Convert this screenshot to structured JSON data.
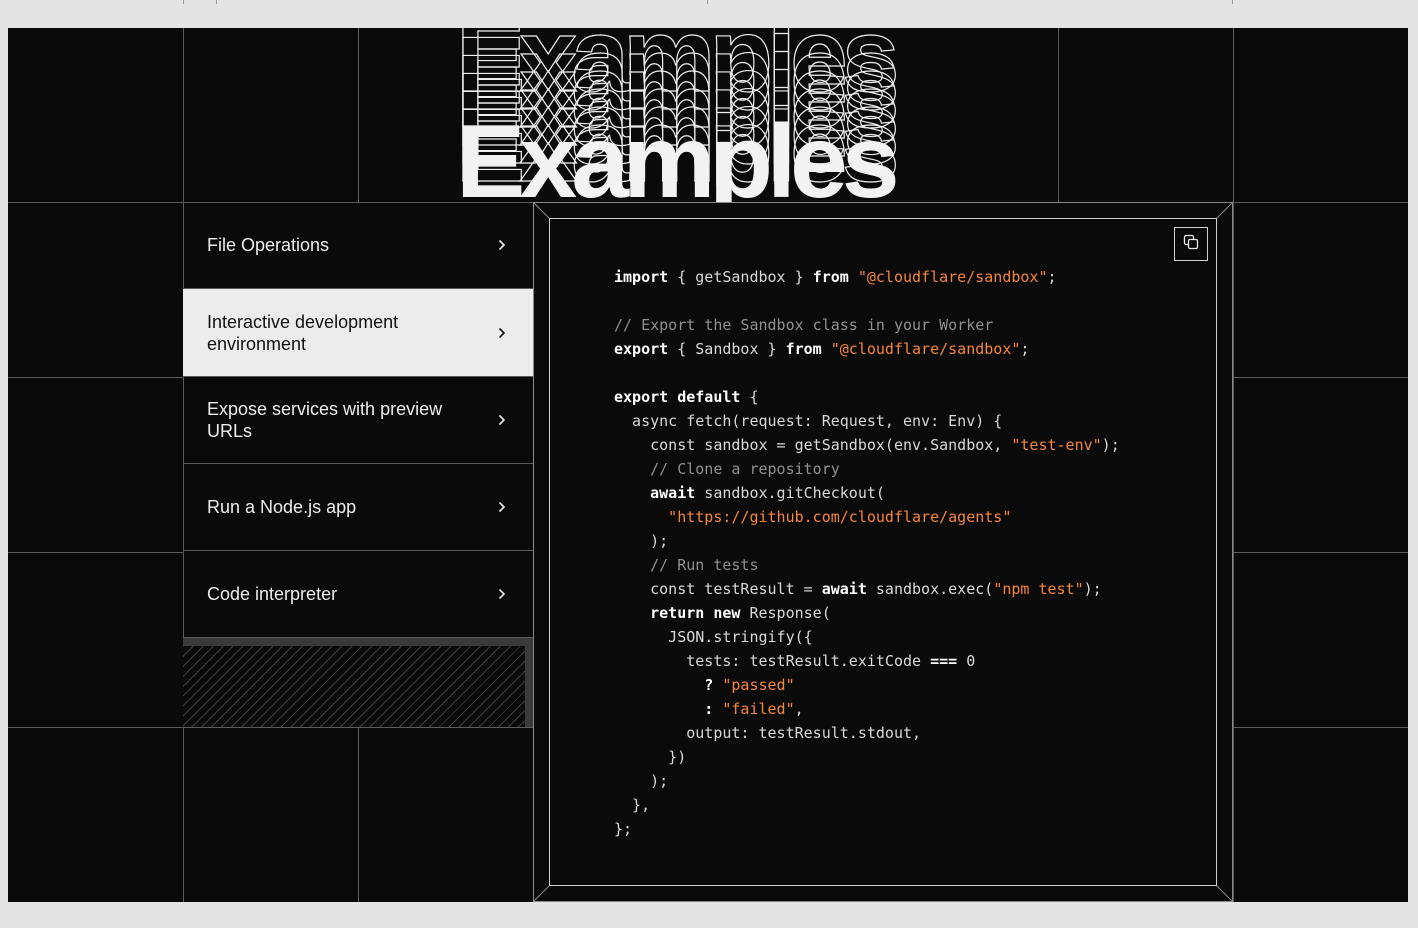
{
  "heading": {
    "title": "Examples"
  },
  "menu": {
    "items": [
      {
        "label": "File Operations",
        "active": false
      },
      {
        "label": "Interactive development environment",
        "active": true
      },
      {
        "label": "Expose services with preview URLs",
        "active": false
      },
      {
        "label": "Run a Node.js app",
        "active": false
      },
      {
        "label": "Code interpreter",
        "active": false
      }
    ]
  },
  "code": {
    "copy_icon": "copy-icon",
    "lines": [
      [
        [
          "kw",
          "import"
        ],
        [
          "t",
          " { getSandbox } "
        ],
        [
          "kw",
          "from"
        ],
        [
          "t",
          " "
        ],
        [
          "str",
          "\"@cloudflare/sandbox\""
        ],
        [
          "t",
          ";"
        ]
      ],
      [],
      [
        [
          "com",
          "// Export the Sandbox class in your Worker"
        ]
      ],
      [
        [
          "kw",
          "export"
        ],
        [
          "t",
          " { Sandbox } "
        ],
        [
          "kw",
          "from"
        ],
        [
          "t",
          " "
        ],
        [
          "str",
          "\"@cloudflare/sandbox\""
        ],
        [
          "t",
          ";"
        ]
      ],
      [],
      [
        [
          "kw",
          "export default"
        ],
        [
          "t",
          " {"
        ]
      ],
      [
        [
          "t",
          "  async fetch(request: Request, env: Env) {"
        ]
      ],
      [
        [
          "t",
          "    const sandbox = getSandbox(env.Sandbox, "
        ],
        [
          "str",
          "\"test-env\""
        ],
        [
          "t",
          ");"
        ]
      ],
      [
        [
          "com",
          "    // Clone a repository"
        ]
      ],
      [
        [
          "kw",
          "    await"
        ],
        [
          "t",
          " sandbox.gitCheckout("
        ]
      ],
      [
        [
          "str",
          "      \"https://github.com/cloudflare/agents\""
        ]
      ],
      [
        [
          "t",
          "    );"
        ]
      ],
      [
        [
          "com",
          "    // Run tests"
        ]
      ],
      [
        [
          "t",
          "    const testResult = "
        ],
        [
          "kw",
          "await"
        ],
        [
          "t",
          " sandbox.exec("
        ],
        [
          "str",
          "\"npm test\""
        ],
        [
          "t",
          ");"
        ]
      ],
      [
        [
          "kw",
          "    return new"
        ],
        [
          "t",
          " Response("
        ]
      ],
      [
        [
          "t",
          "      JSON.stringify({"
        ]
      ],
      [
        [
          "t",
          "        tests: testResult.exitCode "
        ],
        [
          "kw",
          "==="
        ],
        [
          "t",
          " 0"
        ]
      ],
      [
        [
          "kw",
          "          ?"
        ],
        [
          "t",
          " "
        ],
        [
          "str",
          "\"passed\""
        ]
      ],
      [
        [
          "kw",
          "          :"
        ],
        [
          "t",
          " "
        ],
        [
          "str",
          "\"failed\""
        ],
        [
          "t",
          ","
        ]
      ],
      [
        [
          "t",
          "        output: testResult.stdout,"
        ]
      ],
      [
        [
          "t",
          "      })"
        ]
      ],
      [
        [
          "t",
          "    );"
        ]
      ],
      [
        [
          "t",
          "  },"
        ]
      ],
      [
        [
          "t",
          "};"
        ]
      ]
    ]
  }
}
